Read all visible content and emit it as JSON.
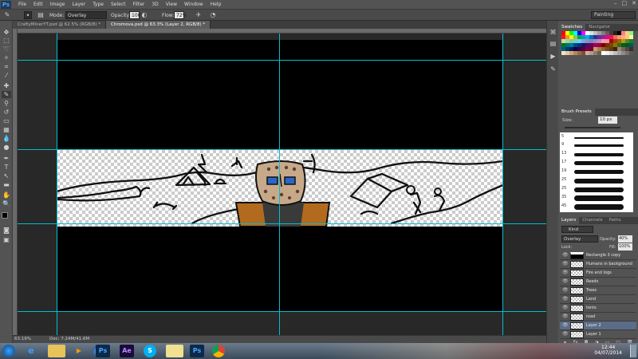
{
  "app": {
    "logo": "Ps"
  },
  "menubar": {
    "items": [
      "File",
      "Edit",
      "Image",
      "Layer",
      "Type",
      "Select",
      "Filter",
      "3D",
      "View",
      "Window",
      "Help"
    ]
  },
  "options": {
    "mode_label": "Mode:",
    "mode_value": "Overlay",
    "opacity_label": "Opacity:",
    "opacity_value": "100%",
    "flow_label": "Flow:",
    "flow_value": "72%",
    "workspace": "Painting"
  },
  "tabs": [
    {
      "label": "CraftyMinerYT.psd @ 62.5% (RGB/8) *"
    },
    {
      "label": "Chromova.psd @ 63.3% (Layer 2, RGB/8) *"
    }
  ],
  "status": {
    "zoom": "63.19%",
    "doc": "Doc: 7.24M/41.6M"
  },
  "swatches": {
    "tabs": [
      "Swatches",
      "Navigator"
    ],
    "colors": [
      "#ff0000",
      "#ffff00",
      "#00ff00",
      "#00ffff",
      "#0000ff",
      "#ff00ff",
      "#ffffff",
      "#e0e0e0",
      "#c0c0c0",
      "#a0a0a0",
      "#808080",
      "#606060",
      "#404040",
      "#202020",
      "#000000",
      "#ff8080",
      "#ffd080",
      "#80ff80",
      "#ed1c24",
      "#f7941d",
      "#fff200",
      "#8dc63f",
      "#00a651",
      "#00a99d",
      "#00aeef",
      "#0072bc",
      "#2e3192",
      "#662d91",
      "#92278f",
      "#ec008c",
      "#ed145b",
      "#f26c4f",
      "#f69679",
      "#fbad7f",
      "#fdc689",
      "#fff799",
      "#c4df9b",
      "#a3d39c",
      "#82ca9c",
      "#7accc8",
      "#6dcff6",
      "#7da7d9",
      "#8393ca",
      "#8781bd",
      "#a187be",
      "#bc8dbf",
      "#f49ac2",
      "#f6989d",
      "#9e0b0f",
      "#a0410d",
      "#a36209",
      "#aba000",
      "#598527",
      "#1a7b30",
      "#007236",
      "#00746b",
      "#0076a3",
      "#004a80",
      "#003471",
      "#1b1464",
      "#440e62",
      "#630460",
      "#9e005d",
      "#9e0039",
      "#790000",
      "#7b2e00",
      "#7d4900",
      "#827b00",
      "#406618",
      "#005e20",
      "#005826",
      "#005952",
      "#005b7f",
      "#003663",
      "#002157",
      "#0d004c",
      "#32004b",
      "#4b0049",
      "#7b0046",
      "#7a0026",
      "#c69c6d",
      "#a67c52",
      "#8c6239",
      "#754c24",
      "#603913",
      "#3c2415",
      "#998675",
      "#736357",
      "#534741",
      "#362f2d",
      "#f5e1c4",
      "#e8c8a0",
      "#d4a574",
      "#b8865a",
      "#9c6a42",
      "#7f5030",
      "#c7b299",
      "#a99d8f",
      "#8b7d6b",
      "#6d5f4f",
      "#ffffff",
      "#f2f2f2",
      "#d9d9d9",
      "#bfbfbf",
      "#a6a6a6",
      "#8c8c8c",
      "#737373",
      "#595959"
    ]
  },
  "brush_presets": {
    "title": "Brush Presets",
    "size_label": "Size:",
    "size_value": "10 px",
    "sizes": [
      "5",
      "9",
      "13",
      "17",
      "19",
      "25",
      "25",
      "35",
      "45"
    ]
  },
  "layers_panel": {
    "tabs": [
      "Layers",
      "Channels",
      "Paths"
    ],
    "kind": "Kind",
    "blend": "Overlay",
    "opacity_label": "Opacity:",
    "opacity_value": "40%",
    "lock_label": "Lock:",
    "fill_label": "Fill:",
    "fill_value": "100%",
    "layers": [
      {
        "name": "Rectangle 3 copy",
        "selected": false,
        "shape": true
      },
      {
        "name": "Humans in background",
        "selected": false
      },
      {
        "name": "Fire and logs",
        "selected": false
      },
      {
        "name": "Reeds",
        "selected": false
      },
      {
        "name": "Trees",
        "selected": false
      },
      {
        "name": "Land",
        "selected": false
      },
      {
        "name": "tents",
        "selected": false
      },
      {
        "name": "road",
        "selected": false
      },
      {
        "name": "Layer 2",
        "selected": true
      },
      {
        "name": "Layer 1",
        "selected": false
      }
    ]
  },
  "taskbar": {
    "apps": [
      {
        "icon": "windows-start-icon",
        "label": ""
      },
      {
        "icon": "ie-icon",
        "label": "e"
      },
      {
        "icon": "folder-icon",
        "label": ""
      },
      {
        "icon": "media-icon",
        "label": "▶"
      },
      {
        "icon": "cinema4d-icon",
        "label": ""
      },
      {
        "icon": "photoshop-icon",
        "label": "Ps"
      },
      {
        "icon": "aftereffects-icon",
        "label": "Ae"
      },
      {
        "icon": "skype-icon",
        "label": "S"
      },
      {
        "icon": "files-icon",
        "label": ""
      },
      {
        "icon": "photoshop-icon-2",
        "label": "Ps"
      },
      {
        "icon": "chrome-icon",
        "label": ""
      }
    ],
    "time": "12:44",
    "date": "04/07/2014"
  }
}
